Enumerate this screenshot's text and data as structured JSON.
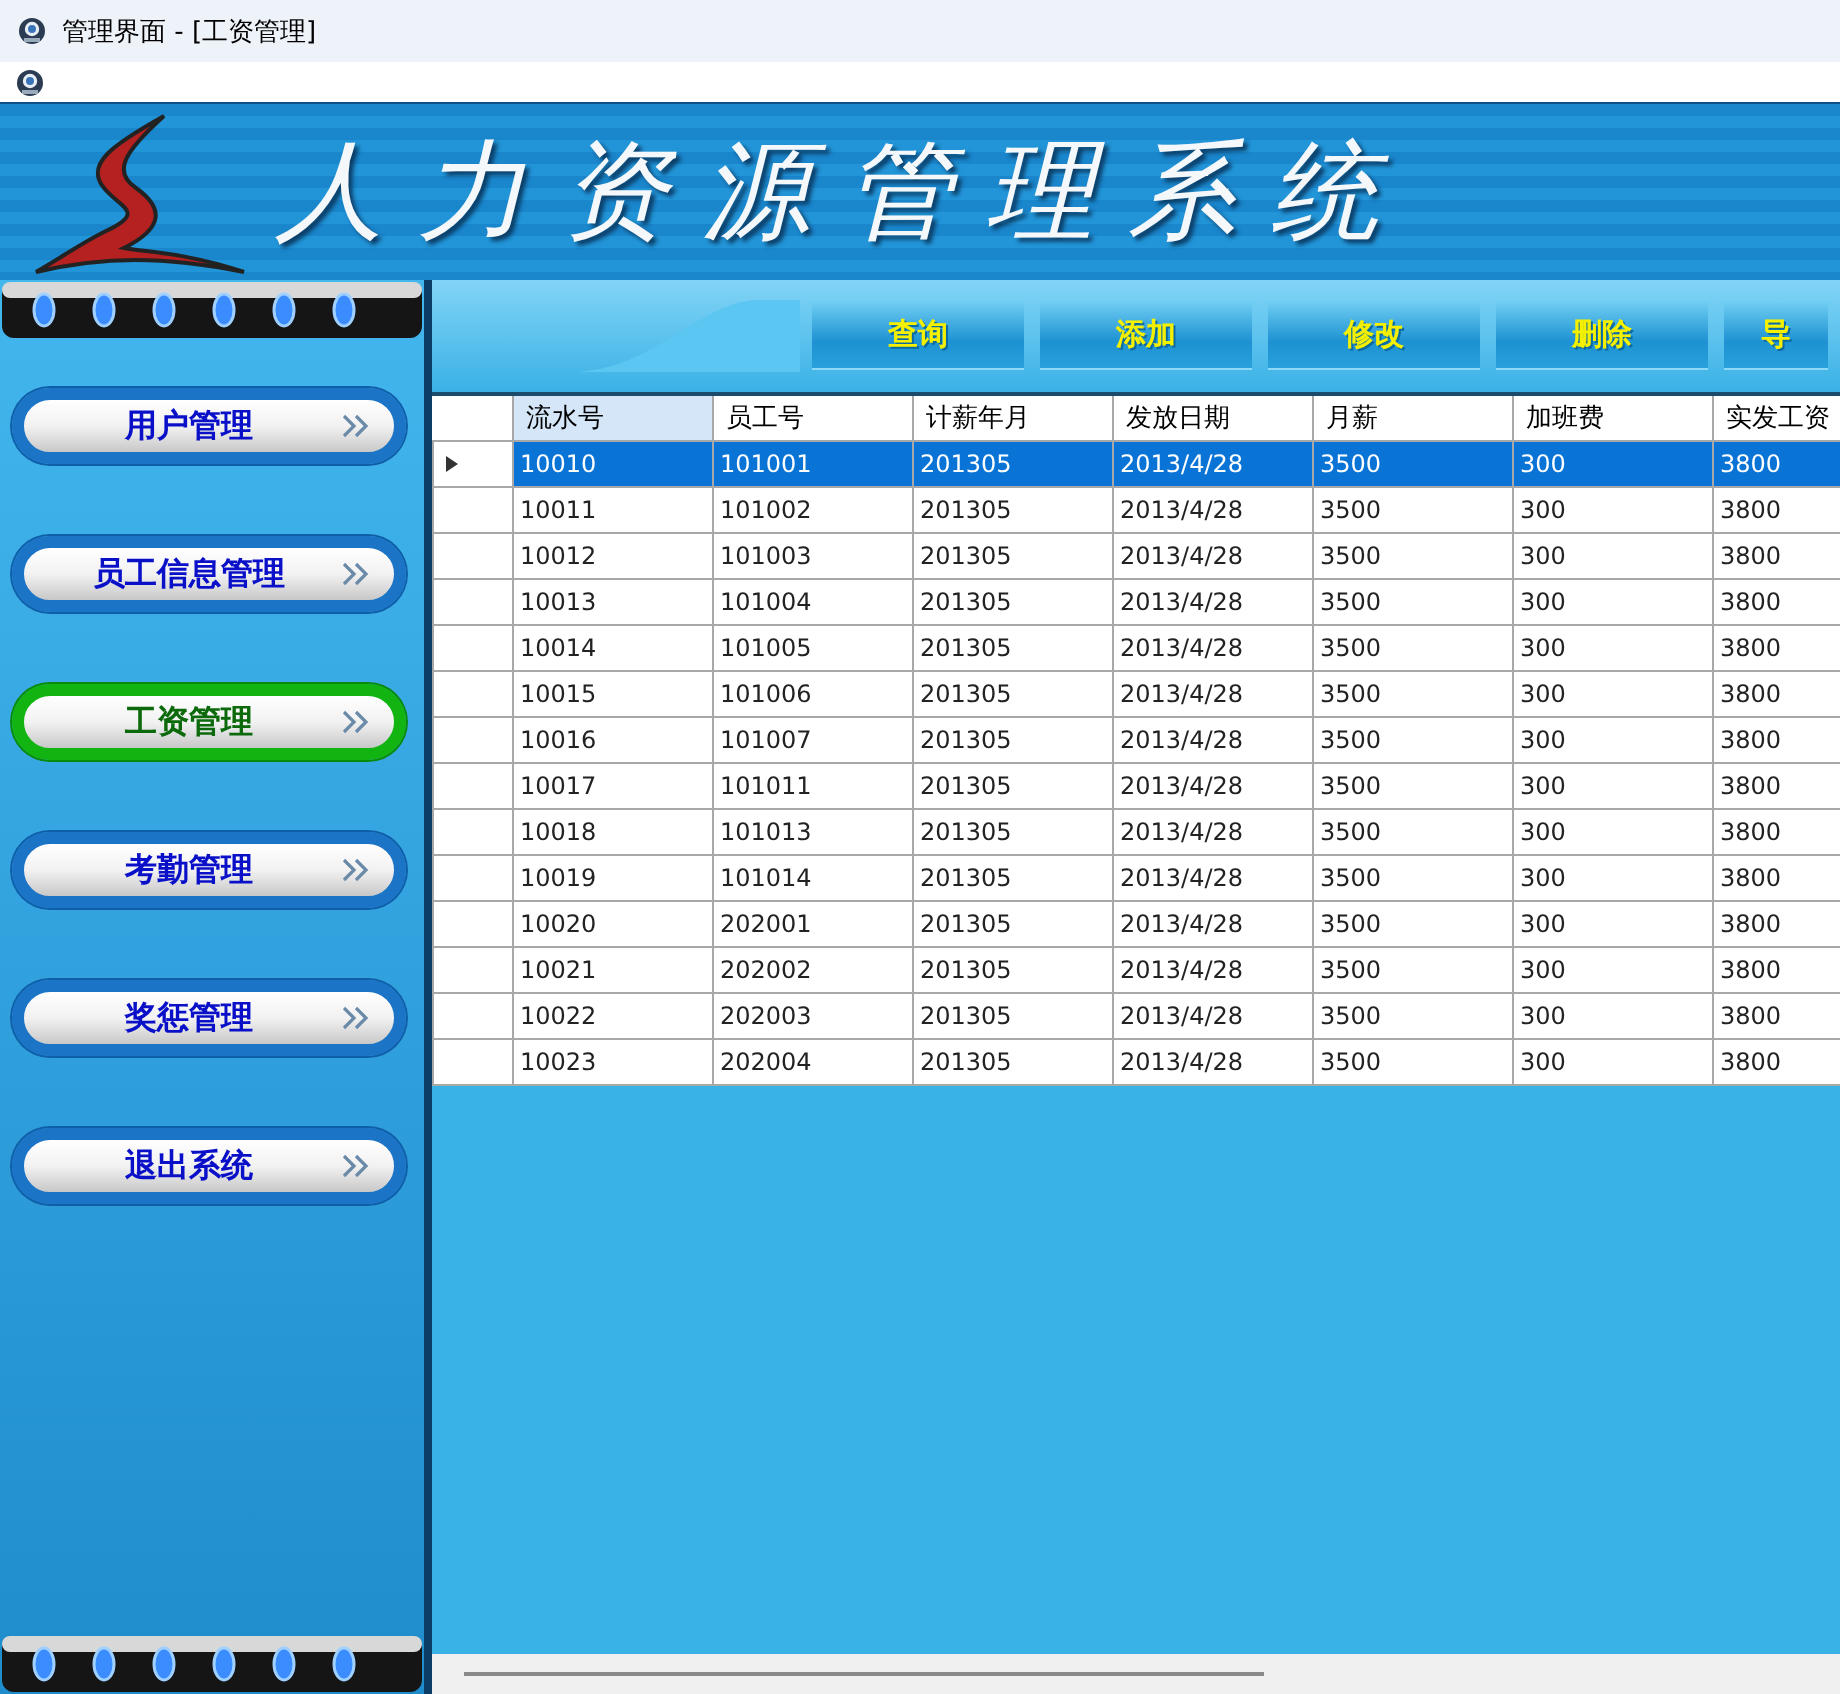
{
  "window": {
    "title": "管理界面 - [工资管理]"
  },
  "banner": {
    "title": "人力资源管理系统"
  },
  "sidebar": {
    "items": [
      {
        "label": "用户管理",
        "selected": false
      },
      {
        "label": "员工信息管理",
        "selected": false
      },
      {
        "label": "工资管理",
        "selected": true
      },
      {
        "label": "考勤管理",
        "selected": false
      },
      {
        "label": "奖惩管理",
        "selected": false
      },
      {
        "label": "退出系统",
        "selected": false
      }
    ]
  },
  "toolbar": {
    "buttons": [
      "查询",
      "添加",
      "修改",
      "删除",
      "导"
    ]
  },
  "table": {
    "columns": [
      {
        "label": "流水号",
        "selected": true
      },
      {
        "label": "员工号",
        "selected": false
      },
      {
        "label": "计薪年月",
        "selected": false
      },
      {
        "label": "发放日期",
        "selected": false
      },
      {
        "label": "月薪",
        "selected": false
      },
      {
        "label": "加班费",
        "selected": false
      },
      {
        "label": "实发工资",
        "selected": false
      }
    ],
    "rows": [
      {
        "selected": true,
        "cells": [
          "10010",
          "101001",
          "201305",
          "2013/4/28",
          "3500",
          "300",
          "3800"
        ]
      },
      {
        "selected": false,
        "cells": [
          "10011",
          "101002",
          "201305",
          "2013/4/28",
          "3500",
          "300",
          "3800"
        ]
      },
      {
        "selected": false,
        "cells": [
          "10012",
          "101003",
          "201305",
          "2013/4/28",
          "3500",
          "300",
          "3800"
        ]
      },
      {
        "selected": false,
        "cells": [
          "10013",
          "101004",
          "201305",
          "2013/4/28",
          "3500",
          "300",
          "3800"
        ]
      },
      {
        "selected": false,
        "cells": [
          "10014",
          "101005",
          "201305",
          "2013/4/28",
          "3500",
          "300",
          "3800"
        ]
      },
      {
        "selected": false,
        "cells": [
          "10015",
          "101006",
          "201305",
          "2013/4/28",
          "3500",
          "300",
          "3800"
        ]
      },
      {
        "selected": false,
        "cells": [
          "10016",
          "101007",
          "201305",
          "2013/4/28",
          "3500",
          "300",
          "3800"
        ]
      },
      {
        "selected": false,
        "cells": [
          "10017",
          "101011",
          "201305",
          "2013/4/28",
          "3500",
          "300",
          "3800"
        ]
      },
      {
        "selected": false,
        "cells": [
          "10018",
          "101013",
          "201305",
          "2013/4/28",
          "3500",
          "300",
          "3800"
        ]
      },
      {
        "selected": false,
        "cells": [
          "10019",
          "101014",
          "201305",
          "2013/4/28",
          "3500",
          "300",
          "3800"
        ]
      },
      {
        "selected": false,
        "cells": [
          "10020",
          "202001",
          "201305",
          "2013/4/28",
          "3500",
          "300",
          "3800"
        ]
      },
      {
        "selected": false,
        "cells": [
          "10021",
          "202002",
          "201305",
          "2013/4/28",
          "3500",
          "300",
          "3800"
        ]
      },
      {
        "selected": false,
        "cells": [
          "10022",
          "202003",
          "201305",
          "2013/4/28",
          "3500",
          "300",
          "3800"
        ]
      },
      {
        "selected": false,
        "cells": [
          "10023",
          "202004",
          "201305",
          "2013/4/28",
          "3500",
          "300",
          "3800"
        ]
      }
    ]
  }
}
